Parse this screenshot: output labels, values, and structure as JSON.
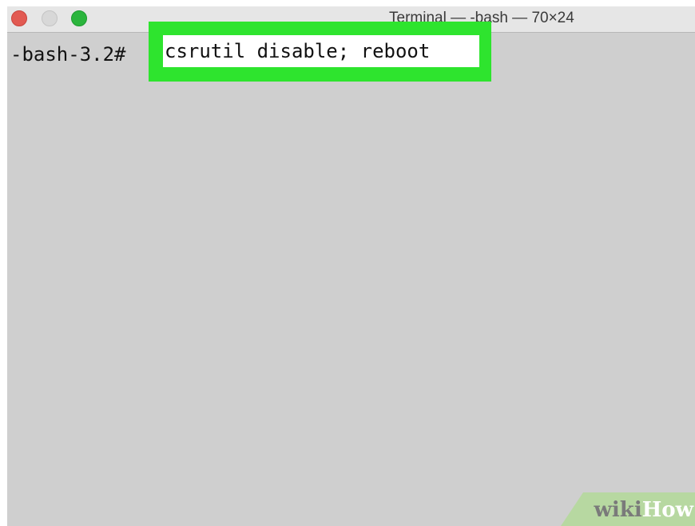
{
  "window": {
    "title": "Terminal — -bash — 70×24"
  },
  "terminal": {
    "prompt": "-bash-3.2#",
    "command": "csrutil disable; reboot"
  },
  "watermark": {
    "wiki": "wiki",
    "how": "How"
  },
  "colors": {
    "highlight": "#2ee42e",
    "terminal_background": "#cfcfcf"
  }
}
